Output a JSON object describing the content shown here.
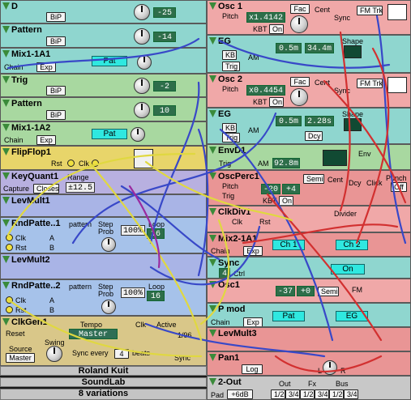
{
  "left": {
    "modules": [
      {
        "name": "D",
        "value": "-25",
        "btn": "BiP"
      },
      {
        "name": "Pattern",
        "value": "-14",
        "btn": "BiP"
      },
      {
        "name": "Mix1-1A1",
        "chain": "Chain",
        "exp": "Exp",
        "pat": "Pat"
      },
      {
        "name": "Trig",
        "value": "-2",
        "btn": "BiP"
      },
      {
        "name": "Pattern",
        "value": "10",
        "btn": "BiP"
      },
      {
        "name": "Mix1-1A2",
        "chain": "Chain",
        "exp": "Exp",
        "pat": "Pat"
      },
      {
        "name": "FlipFlop1",
        "rst": "Rst",
        "clk": "Clk"
      },
      {
        "name": "KeyQuant1",
        "capture": "Capture",
        "closes": "Closes",
        "range": "Range",
        "range_val": "±12.5"
      },
      {
        "name": "LevMult1"
      },
      {
        "name": "RndPatte..1",
        "pattern": "pattern",
        "step": "Step",
        "prob": "Prob",
        "prob_val": "100%",
        "loop": "Loop",
        "loop_val": "16",
        "clk": "Clk",
        "rst": "Rst",
        "a": "A",
        "b": "B"
      },
      {
        "name": "LevMult2"
      },
      {
        "name": "RndPatte..2",
        "pattern": "pattern",
        "step": "Step",
        "prob": "Prob",
        "prob_val": "100%",
        "loop": "Loop",
        "loop_val": "16",
        "clk": "Clk",
        "rst": "Rst",
        "a": "A",
        "b": "B"
      },
      {
        "name": "ClkGen1",
        "reset": "Reset",
        "tempo": "Tempo",
        "tempo_val": "Master",
        "clk": "Clk",
        "active": "Active",
        "div": "1/96",
        "source": "Source",
        "source_val": "Master",
        "swing": "Swing",
        "sync_every": "Sync every",
        "sync_val": "4",
        "beats": "beats",
        "sync": "Sync"
      }
    ],
    "footer": [
      "Roland Kuit",
      "SoundLab",
      "8 variations"
    ]
  },
  "right": {
    "modules": [
      {
        "name": "Osc 1",
        "pitch": "Pitch",
        "fac": "Fac",
        "cent": "Cent",
        "ratio": "x1.4142",
        "kbt": "KBT",
        "on": "On",
        "sync": "Sync",
        "fm": "FM Trk"
      },
      {
        "name": "EG",
        "kb": "KB",
        "trig": "Trig",
        "am": "AM",
        "a": "0.5m",
        "d": "34.4m",
        "shape": "Shape"
      },
      {
        "name": "Osc 2",
        "pitch": "Pitch",
        "fac": "Fac",
        "cent": "Cent",
        "ratio": "x0.4454",
        "kbt": "KBT",
        "on": "On",
        "sync": "Sync",
        "fm": "FM Trk"
      },
      {
        "name": "EG",
        "kb": "KB",
        "trig": "Trig",
        "am": "AM",
        "a": "0.5m",
        "d": "2.28s",
        "dcy": "Dcy",
        "shape": "Shape"
      },
      {
        "name": "EnvD1",
        "trig": "Trig",
        "am": "AM",
        "time": "92.8m",
        "env": "Env"
      },
      {
        "name": "OscPerc1",
        "pitch": "Pitch",
        "trig": "Trig",
        "semi": "Semi",
        "cent": "Cent",
        "v1": "-20",
        "v2": "+4",
        "kbt": "KBT",
        "on": "On",
        "dcy": "Dcy",
        "click": "Click",
        "punch": "Punch",
        "off": "Off"
      },
      {
        "name": "ClkDiv1",
        "clk": "Clk",
        "rst": "Rst",
        "divider": "Divider"
      },
      {
        "name": "Mix2-1A1",
        "chain": "Chain",
        "exp": "Exp",
        "ch1": "Ch 1",
        "ch2": "Ch 2"
      },
      {
        "name": "Sync",
        "ctrl": "Ctrl",
        "val": "4",
        "on": "On"
      },
      {
        "name": "Osc1",
        "v1": "-37",
        "v2": "+0",
        "semi": "Semi",
        "fm": "FM"
      },
      {
        "name": "P mod",
        "chain": "Chain",
        "exp": "Exp",
        "pat": "Pat",
        "eg": "EG"
      },
      {
        "name": "LevMult3"
      },
      {
        "name": "Pan1",
        "log": "Log",
        "l": "L",
        "r": "R"
      },
      {
        "name": "2-Out",
        "pad": "Pad",
        "pad_val": "+6dB",
        "out": "Out",
        "fx": "Fx",
        "bus": "Bus",
        "o1": "1/2",
        "o2": "3/4"
      }
    ]
  },
  "colors": {
    "teal": "#8fd6cf",
    "green": "#a8d8a0",
    "yellow": "#e8d56a",
    "pink": "#f0a8a8",
    "blue_cable": "#3848c8",
    "red_cable": "#d23030",
    "yellow_cable": "#e0d840"
  }
}
